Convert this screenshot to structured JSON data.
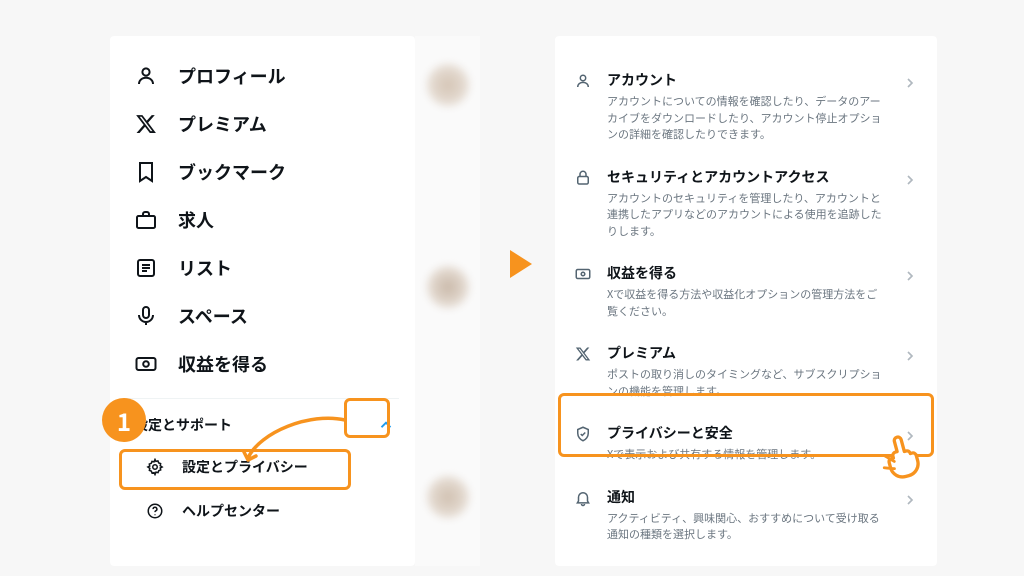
{
  "nav": {
    "profile": "プロフィール",
    "premium": "プレミアム",
    "bookmarks": "ブックマーク",
    "jobs": "求人",
    "lists": "リスト",
    "spaces": "スペース",
    "monetize": "収益を得る"
  },
  "support": {
    "header": "設定とサポート",
    "settings_privacy": "設定とプライバシー",
    "help_center": "ヘルプセンター"
  },
  "settings": {
    "account": {
      "title": "アカウント",
      "desc": "アカウントについての情報を確認したり、データのアーカイブをダウンロードしたり、アカウント停止オプションの詳細を確認したりできます。"
    },
    "security": {
      "title": "セキュリティとアカウントアクセス",
      "desc": "アカウントのセキュリティを管理したり、アカウントと連携したアプリなどのアカウントによる使用を追跡したりします。"
    },
    "monetize": {
      "title": "収益を得る",
      "desc": "Xで収益を得る方法や収益化オプションの管理方法をご覧ください。"
    },
    "premium": {
      "title": "プレミアム",
      "desc": "ポストの取り消しのタイミングなど、サブスクリプションの機能を管理します。"
    },
    "privacy": {
      "title": "プライバシーと安全",
      "desc": "Xで表示および共有する情報を管理します。"
    },
    "notifications": {
      "title": "通知",
      "desc": "アクティビティ、興味関心、おすすめについて受け取る通知の種類を選択します。"
    }
  },
  "marker": "1"
}
